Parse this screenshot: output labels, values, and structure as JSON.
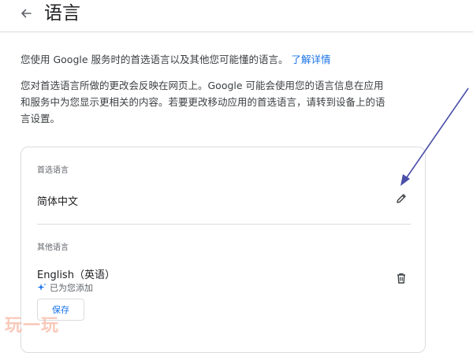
{
  "header": {
    "back_icon": "arrow-left-icon",
    "title": "语言"
  },
  "intro": {
    "text": "您使用 Google 服务时的首选语言以及其他您可能懂的语言。",
    "link": "了解详情"
  },
  "description": "您对首选语言所做的更改会反映在网页上。Google 可能会使用您的语言信息在应用和服务中为您显示更相关的内容。若要更改移动应用的首选语言，请转到设备上的语言设置。",
  "preferred": {
    "label": "首选语言",
    "language": "简体中文",
    "edit_icon": "pencil-icon"
  },
  "other": {
    "label": "其他语言",
    "language": "English（英语）",
    "added_text": "已为您添加",
    "sparkle_icon": "sparkle-icon",
    "delete_icon": "trash-icon",
    "save_label": "保存"
  },
  "watermark": "玩一玩",
  "colors": {
    "link": "#1a73e8",
    "annotation_arrow": "#4a4fa8",
    "watermark": "#f6b8a3"
  }
}
